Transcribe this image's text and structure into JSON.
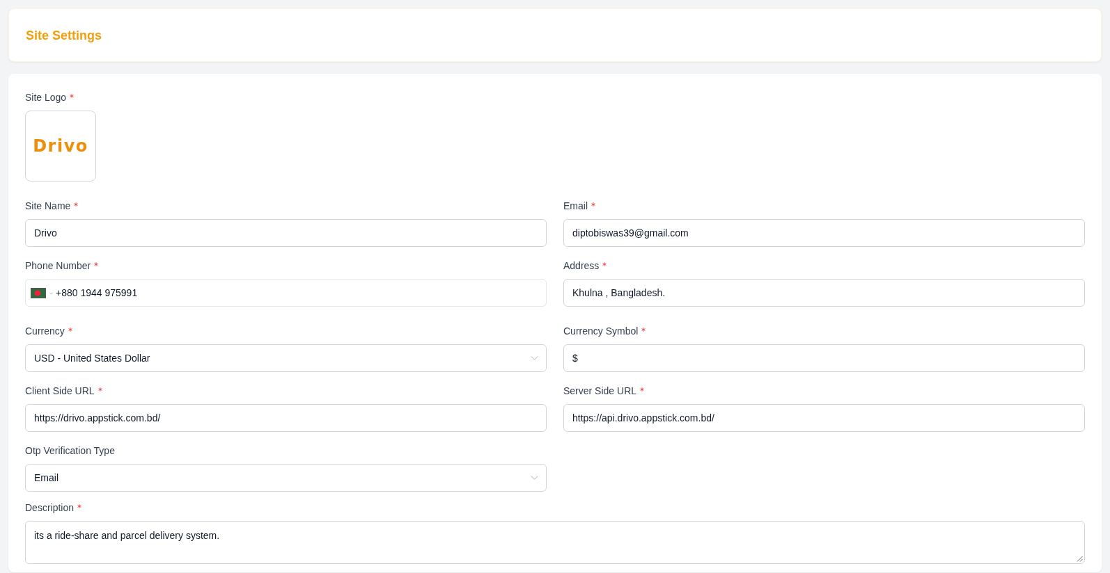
{
  "page": {
    "title": "Site Settings"
  },
  "form": {
    "logo": {
      "label": "Site Logo",
      "required": true,
      "logo_text": "Drivo"
    },
    "fields": [
      {
        "kind": "text",
        "label": "Site Name",
        "required": true,
        "value": "Drivo"
      },
      {
        "kind": "text",
        "label": "Email",
        "required": true,
        "value": "diptobiswas39@gmail.com"
      },
      {
        "kind": "phone",
        "label": "Phone Number",
        "required": true,
        "value": "+880 1944 975991"
      },
      {
        "kind": "text",
        "label": "Address",
        "required": true,
        "value": "Khulna , Bangladesh."
      },
      {
        "kind": "select",
        "label": "Currency",
        "required": true,
        "value": "USD - United States Dollar"
      },
      {
        "kind": "text",
        "label": "Currency Symbol",
        "required": true,
        "value": "$"
      },
      {
        "kind": "text",
        "label": "Client Side URL",
        "required": true,
        "value": "https://drivo.appstick.com.bd/"
      },
      {
        "kind": "text",
        "label": "Server Side URL",
        "required": true,
        "value": "https://api.drivo.appstick.com.bd/"
      },
      {
        "kind": "select",
        "label": "Otp Verification Type",
        "required": false,
        "value": "Email"
      },
      {
        "kind": "textarea",
        "label": "Description",
        "required": true,
        "value": "its a ride-share and parcel delivery system."
      }
    ]
  }
}
